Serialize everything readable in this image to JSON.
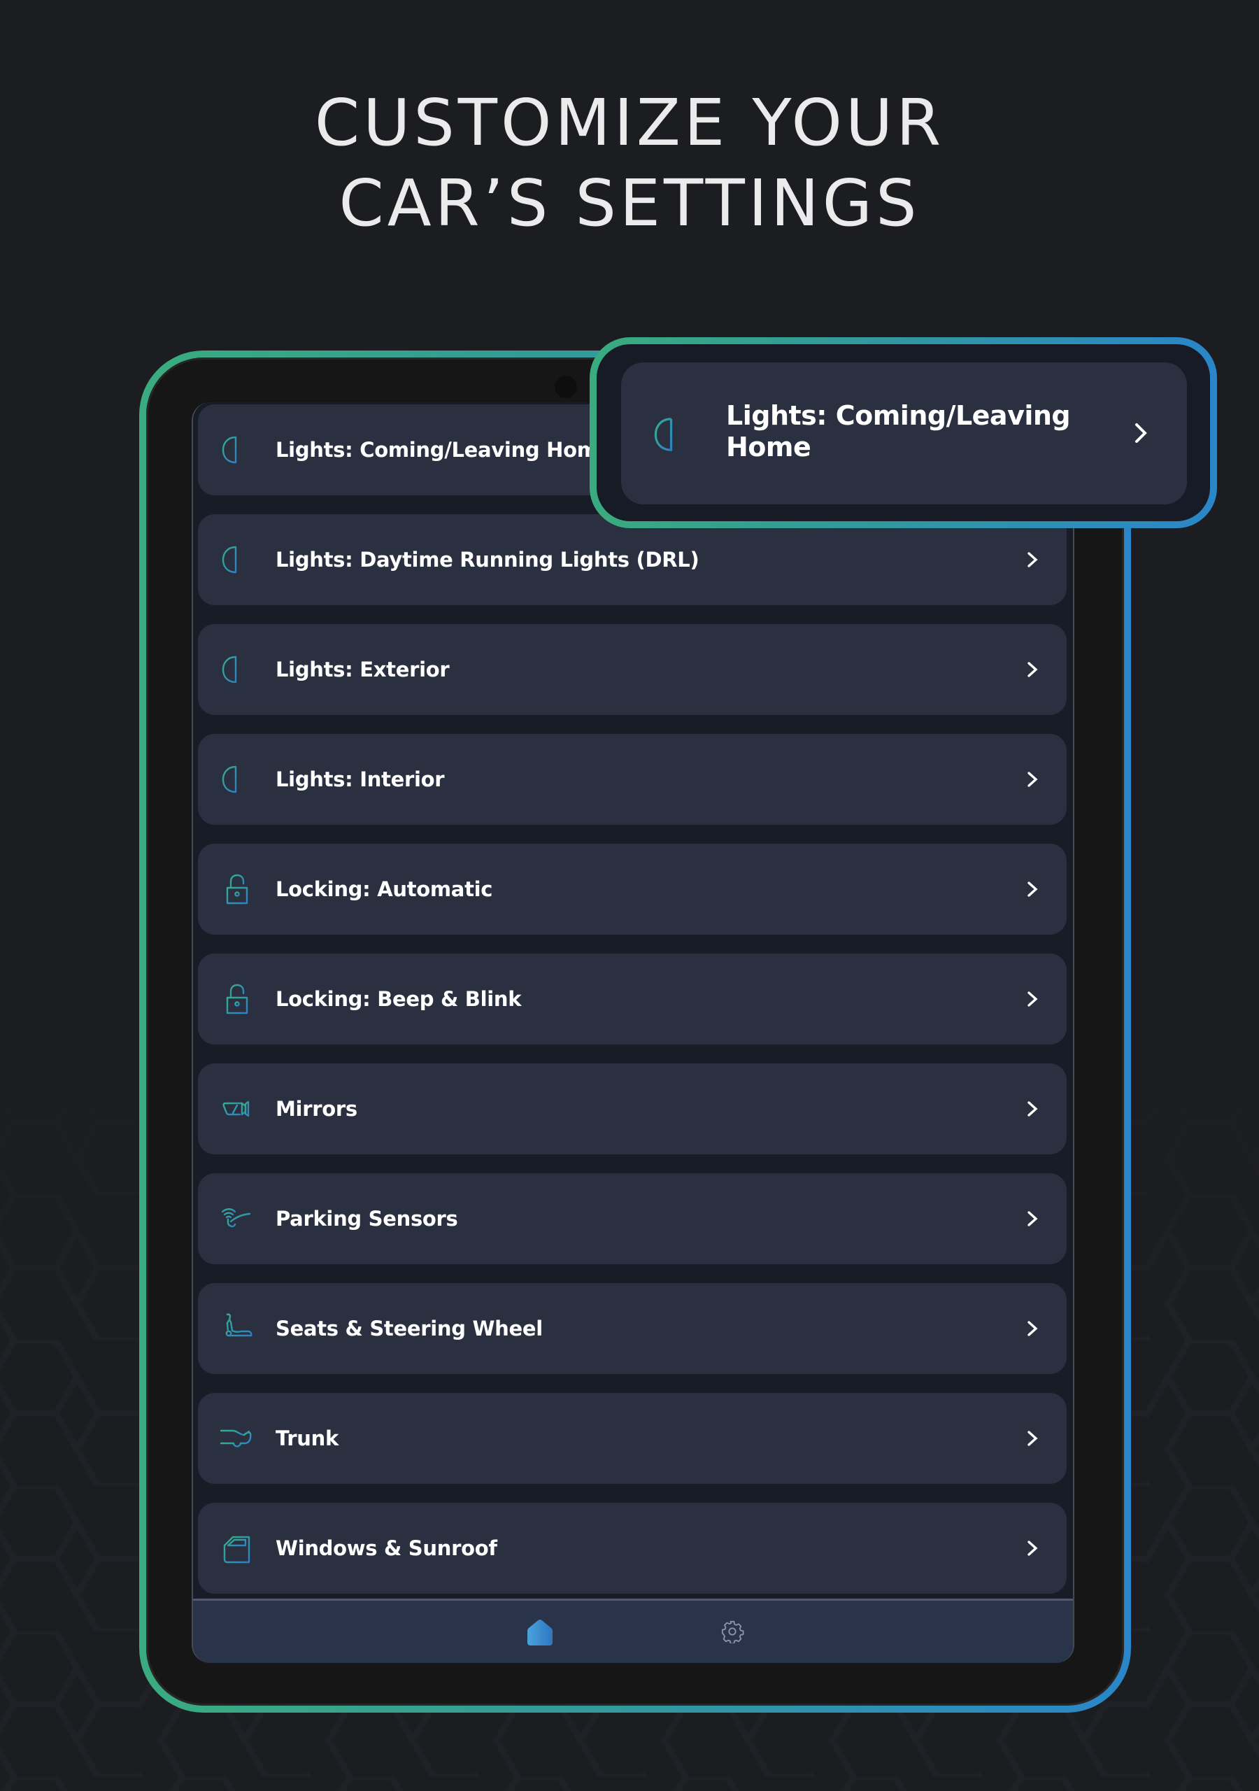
{
  "headline": {
    "line1": "CUSTOMIZE YOUR",
    "line2": "CAR’S SETTINGS"
  },
  "colors": {
    "background": "#1c1d20",
    "frame_gradient_start": "#3aab7f",
    "frame_gradient_end": "#2a86c8",
    "row_background": "#2a3040",
    "screen_background": "#171c27",
    "navbar_background": "#29344a",
    "text": "#ffffff",
    "icon_teal": "#34a89a",
    "icon_blue": "#2f86c4",
    "nav_active": "#3d8fd6",
    "nav_inactive": "#8a94a8"
  },
  "callout": {
    "label": "Lights: Coming/Leaving Home",
    "icon": "headlight-icon"
  },
  "settings_list": [
    {
      "label": "Lights: Coming/Leaving Home",
      "icon": "headlight-icon"
    },
    {
      "label": "Lights: Daytime Running Lights (DRL)",
      "icon": "headlight-icon"
    },
    {
      "label": "Lights: Exterior",
      "icon": "headlight-icon"
    },
    {
      "label": "Lights: Interior",
      "icon": "headlight-icon"
    },
    {
      "label": "Locking: Automatic",
      "icon": "padlock-icon"
    },
    {
      "label": "Locking: Beep & Blink",
      "icon": "padlock-icon"
    },
    {
      "label": "Mirrors",
      "icon": "mirror-icon"
    },
    {
      "label": "Parking Sensors",
      "icon": "parking-sensor-icon"
    },
    {
      "label": "Seats & Steering Wheel",
      "icon": "seat-icon"
    },
    {
      "label": "Trunk",
      "icon": "trunk-icon"
    },
    {
      "label": "Windows & Sunroof",
      "icon": "car-door-window-icon"
    }
  ],
  "navbar": {
    "items": [
      {
        "name": "home",
        "icon": "home-icon",
        "active": true
      },
      {
        "name": "settings",
        "icon": "gear-icon",
        "active": false
      }
    ]
  }
}
